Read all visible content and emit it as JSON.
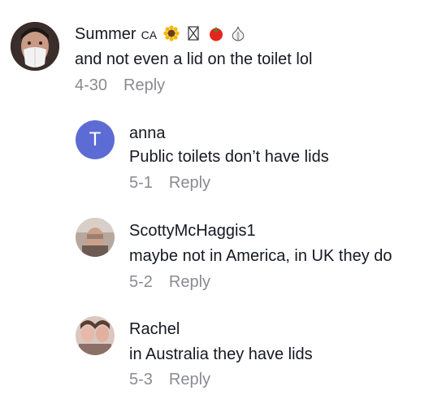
{
  "comments": [
    {
      "username": "Summer",
      "badge": "CA",
      "badge_emojis": [
        "sunflower-icon",
        "hourglass-icon",
        "tomato-icon",
        "garlic-icon"
      ],
      "text": "and not even a lid on the toilet lol",
      "date": "4-30",
      "reply_label": "Reply"
    }
  ],
  "replies": [
    {
      "username": "anna",
      "avatar_letter": "T",
      "avatar_color": "#5d6bd4",
      "text": "Public toilets don’t have lids",
      "date": "5-1",
      "reply_label": "Reply"
    },
    {
      "username": "ScottyMcHaggis1",
      "text": "maybe not in America, in UK they do",
      "date": "5-2",
      "reply_label": "Reply"
    },
    {
      "username": "Rachel",
      "text": "in Australia they have lids",
      "date": "5-3",
      "reply_label": "Reply"
    }
  ]
}
